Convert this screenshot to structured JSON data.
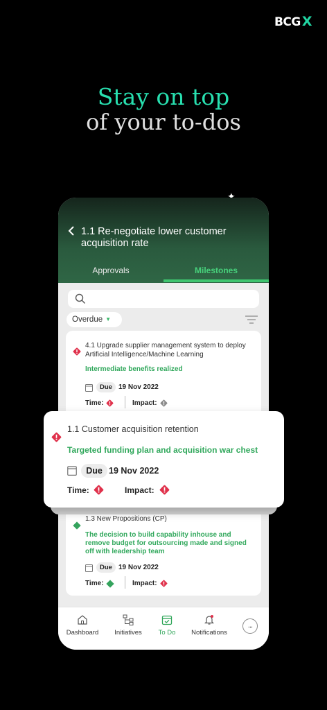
{
  "brand": {
    "name": "BCG",
    "mark": "X"
  },
  "hero": {
    "line1": "Stay on top",
    "line2": "of your to-dos"
  },
  "screen": {
    "back_icon": "chevron-left-icon",
    "title": "1.1 Re-negotiate lower customer acquisition rate",
    "tabs": [
      {
        "label": "Approvals",
        "active": false
      },
      {
        "label": "Milestones",
        "active": true
      }
    ],
    "search": {
      "placeholder": ""
    },
    "filter": {
      "label": "Overdue"
    }
  },
  "milestones": [
    {
      "title": "4.1 Upgrade supplier management system to deploy Artificial Intelligence/Machine Learning",
      "status": "Intermediate benefits realized",
      "due_label": "Due",
      "due_date": "19 Nov 2022",
      "time_label": "Time:",
      "impact_label": "Impact:",
      "status_icon": "warning-red-icon",
      "time_icon": "warning-red-icon",
      "impact_icon": "warning-grey-icon"
    },
    {
      "title": "1.3 New Propositions (CP)",
      "status": "The decision to build capability inhouse and remove budget for outsourcing made and signed off with leadership team",
      "due_label": "Due",
      "due_date": "19 Nov 2022",
      "time_label": "Time:",
      "impact_label": "Impact:",
      "status_icon": "diamond-green-icon",
      "time_icon": "diamond-green-icon",
      "impact_icon": "warning-red-icon"
    }
  ],
  "highlight": {
    "title": "1.1 Customer acquisition retention",
    "status": "Targeted funding plan and acquisition war chest",
    "due_label": "Due",
    "due_date": "19 Nov 2022",
    "time_label": "Time:",
    "impact_label": "Impact:"
  },
  "nav": [
    {
      "label": "Dashboard",
      "icon": "home-icon",
      "active": false
    },
    {
      "label": "Initiatives",
      "icon": "hierarchy-icon",
      "active": false
    },
    {
      "label": "To Do",
      "icon": "calendar-check-icon",
      "active": true
    },
    {
      "label": "Notifications",
      "icon": "bell-icon",
      "active": false
    },
    {
      "label": "...",
      "icon": "more-icon",
      "active": false
    }
  ],
  "colors": {
    "accent": "#3fc46f",
    "hero_accent": "#28e0b0",
    "warning": "#e0314b",
    "header_green": "#2f6645"
  }
}
